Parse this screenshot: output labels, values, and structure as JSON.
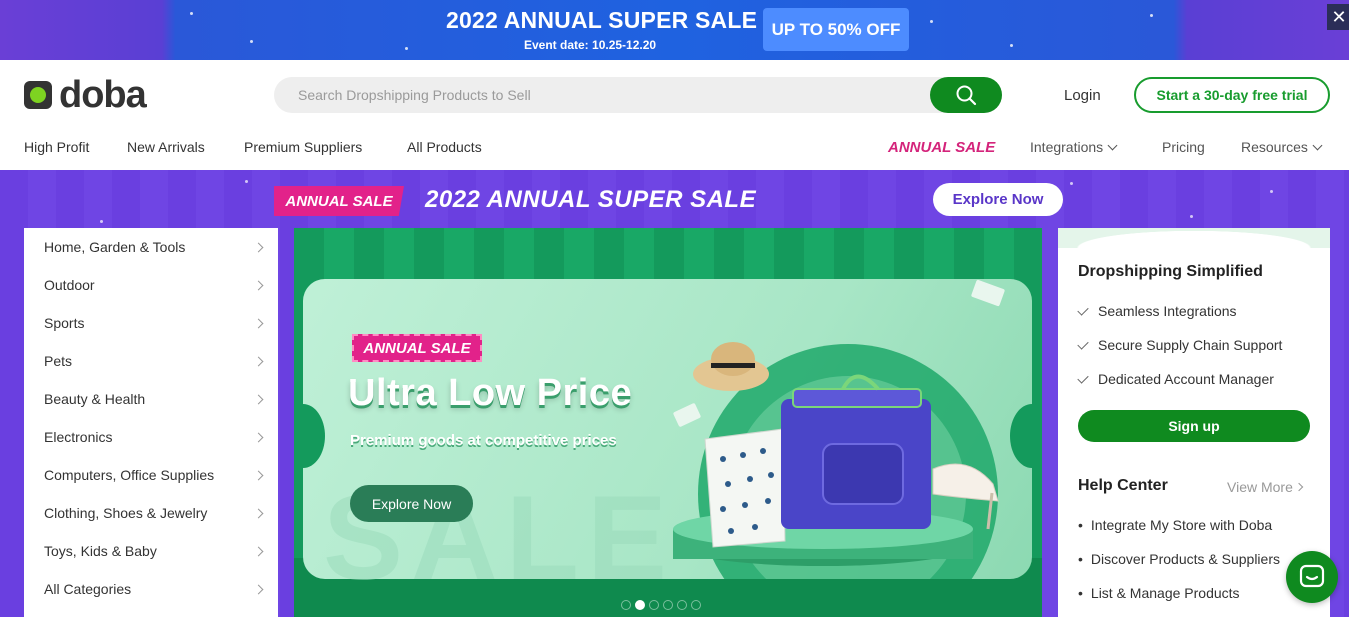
{
  "promo": {
    "title": "2022 ANNUAL SUPER SALE",
    "event_date": "Event date: 10.25-12.20",
    "badge": "UP TO 50% OFF",
    "close_glyph": "✕"
  },
  "header": {
    "logo_text": "doba",
    "search": {
      "placeholder": "Search Dropshipping Products to Sell",
      "value": ""
    },
    "login_label": "Login",
    "trial_label": "Start a 30-day free trial",
    "nav_left": [
      "High Profit",
      "New Arrivals",
      "Premium Suppliers",
      "All Products"
    ],
    "nav_annual": "ANNUAL SALE",
    "nav_right": {
      "integrations": "Integrations",
      "pricing": "Pricing",
      "resources": "Resources"
    }
  },
  "hero_band": {
    "tag": "ANNUAL SALE",
    "title": "2022 ANNUAL SUPER SALE",
    "explore_label": "Explore Now"
  },
  "categories": [
    "Home, Garden & Tools",
    "Outdoor",
    "Sports",
    "Pets",
    "Beauty & Health",
    "Electronics",
    "Computers, Office Supplies",
    "Clothing, Shoes & Jewelry",
    "Toys, Kids & Baby",
    "All Categories"
  ],
  "slide": {
    "tag": "ANNUAL SALE",
    "title": "Ultra Low Price",
    "subtitle": "Premium goods at competitive prices",
    "button_label": "Explore Now",
    "background_word": "SALE",
    "dot_count": 6,
    "active_dot": 1
  },
  "panel": {
    "heading": "Dropshipping Simplified",
    "features": [
      "Seamless Integrations",
      "Secure Supply Chain Support",
      "Dedicated Account Manager"
    ],
    "signup_label": "Sign up",
    "help_heading": "Help Center",
    "view_more": "View More",
    "help_links": [
      "Integrate My Store with Doba",
      "Discover Products & Suppliers",
      "List & Manage Products"
    ]
  },
  "colors": {
    "brand_green": "#0f8a1f",
    "accent_pink": "#e2228a",
    "band_purple": "#6a3fe0",
    "promo_blue": "#1f62e0"
  },
  "icons": [
    "close-icon",
    "search-icon",
    "chevron-down-icon",
    "chevron-right-icon",
    "check-icon",
    "chat-icon"
  ]
}
